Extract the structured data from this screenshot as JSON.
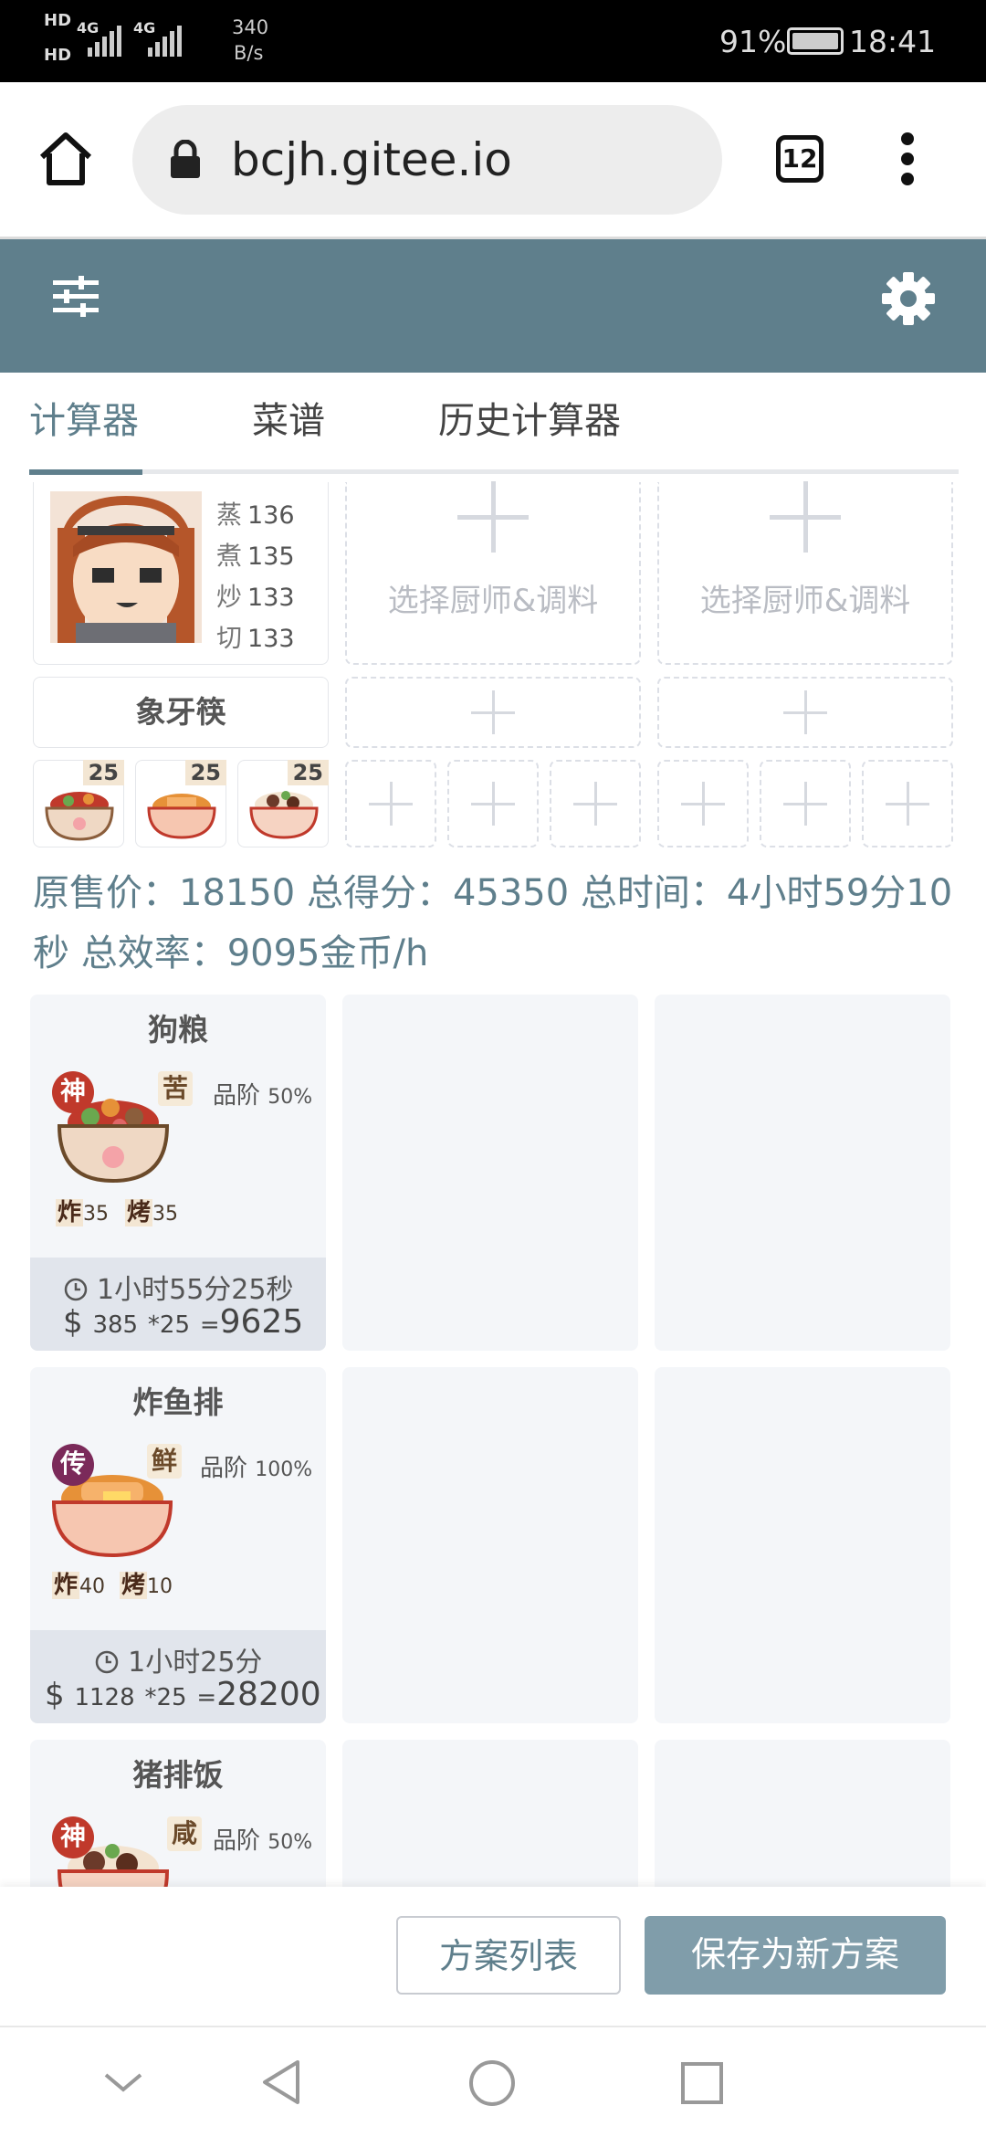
{
  "status_bar": {
    "sim1": "HD",
    "sim2": "HD",
    "net1": "4G",
    "net2": "4G",
    "speed_value": "340",
    "speed_unit": "B/s",
    "battery": "91%",
    "time": "18:41"
  },
  "browser": {
    "url": "bcjh.gitee.io",
    "tab_count": "12"
  },
  "app": {
    "header_color": "#5f7f8c",
    "tabs": [
      {
        "label": "计算器",
        "active": true
      },
      {
        "label": "菜谱",
        "active": false
      },
      {
        "label": "历史计算器",
        "active": false
      }
    ]
  },
  "chef_slot": {
    "stats": [
      {
        "skill": "蒸",
        "value": "136"
      },
      {
        "skill": "煮",
        "value": "135"
      },
      {
        "skill": "炒",
        "value": "133"
      },
      {
        "skill": "切",
        "value": "133"
      }
    ],
    "equip_name": "象牙筷",
    "recipe_counts": [
      "25",
      "25",
      "25"
    ]
  },
  "empty_slot_label": "选择厨师&调料",
  "summary": {
    "text": "原售价：18150 总得分：45350 总时间：4小时59分10秒 总效率：9095金币/h"
  },
  "recipes": [
    {
      "name": "狗粮",
      "rank_badge": "神",
      "taste": "苦",
      "grade_label": "品阶",
      "grade_pct": "50%",
      "skills": [
        {
          "name": "炸",
          "value": "35"
        },
        {
          "name": "烤",
          "value": "35"
        }
      ],
      "time": "1小时55分25秒",
      "price": "385",
      "qty": "*25",
      "eq": "=",
      "total": "9625"
    },
    {
      "name": "炸鱼排",
      "rank_badge": "传",
      "taste": "鲜",
      "grade_label": "品阶",
      "grade_pct": "100%",
      "skills": [
        {
          "name": "炸",
          "value": "40"
        },
        {
          "name": "烤",
          "value": "10"
        }
      ],
      "time": "1小时25分",
      "price": "1128",
      "qty": "*25",
      "eq": "=",
      "total": "28200"
    },
    {
      "name": "猪排饭",
      "rank_badge": "神",
      "taste": "咸",
      "grade_label": "品阶",
      "grade_pct": "50%"
    }
  ],
  "bottom_buttons": {
    "list": "方案列表",
    "save": "保存为新方案"
  },
  "icons": {
    "home": "home-icon",
    "lock": "lock-icon",
    "menu": "more-vert-icon",
    "filter": "sliders-icon",
    "settings": "gear-icon",
    "clock": "clock-icon"
  }
}
